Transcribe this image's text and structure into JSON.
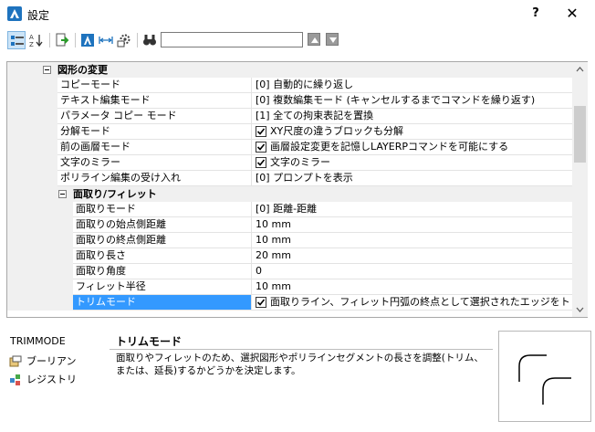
{
  "window": {
    "title": "設定",
    "help_label": "?",
    "close_label": "✕"
  },
  "toolbar": {
    "search_value": "",
    "search_placeholder": "",
    "prev_label": "▲",
    "next_label": "▼",
    "icons": [
      "categorized-view-icon",
      "alphabetical-view-icon",
      "export-icon",
      "drawing-settings-icon",
      "dimension-settings-icon",
      "options-icon",
      "find-icon"
    ]
  },
  "grid": {
    "category": {
      "label": "図形の変更"
    },
    "rows": [
      {
        "name": "コピーモード",
        "value": "[0] 自動的に繰り返し"
      },
      {
        "name": "テキスト編集モード",
        "value": "[0] 複数編集モード (キャンセルするまでコマンドを繰り返す)"
      },
      {
        "name": "パラメータ コピー モード",
        "value": "[1] 全ての拘束表記を置換"
      },
      {
        "name": "分解モード",
        "value": "XY尺度の違うブロックも分解",
        "checkbox": true,
        "checked": true
      },
      {
        "name": "前の画層モード",
        "value": "画層設定変更を記憶しLAYERPコマンドを可能にする",
        "checkbox": true,
        "checked": true
      },
      {
        "name": "文字のミラー",
        "value": "文字のミラー",
        "checkbox": true,
        "checked": true
      },
      {
        "name": "ポリライン編集の受け入れ",
        "value": "[0] プロンプトを表示"
      }
    ],
    "subcategory": {
      "label": "面取り/フィレット",
      "rows": [
        {
          "name": "面取りモード",
          "value": "[0] 距離-距離"
        },
        {
          "name": "面取りの始点側距離",
          "value": "10 mm"
        },
        {
          "name": "面取りの終点側距離",
          "value": "10 mm"
        },
        {
          "name": "面取り長さ",
          "value": "20 mm"
        },
        {
          "name": "面取り角度",
          "value": "0"
        },
        {
          "name": "フィレット半径",
          "value": "10 mm"
        },
        {
          "name": "トリムモード",
          "value": "面取りライン、フィレット円弧の終点として選択されたエッジをトリム",
          "checkbox": true,
          "checked": true,
          "selected": true
        }
      ]
    }
  },
  "info": {
    "variable": "TRIMMODE",
    "links": [
      {
        "label": "ブーリアン",
        "icon": "boolean-icon"
      },
      {
        "label": "レジストリ",
        "icon": "registry-icon"
      }
    ],
    "title": "トリムモード",
    "description": "面取りやフィレットのため、選択図形やポリラインセグメントの長さを調整(トリム、または、延長)するかどうかを決定します。"
  },
  "colors": {
    "selection": "#3399ff",
    "gutter": "#f0f0f0",
    "grid_line": "#e3e3e3",
    "accent": "#1e73be"
  }
}
